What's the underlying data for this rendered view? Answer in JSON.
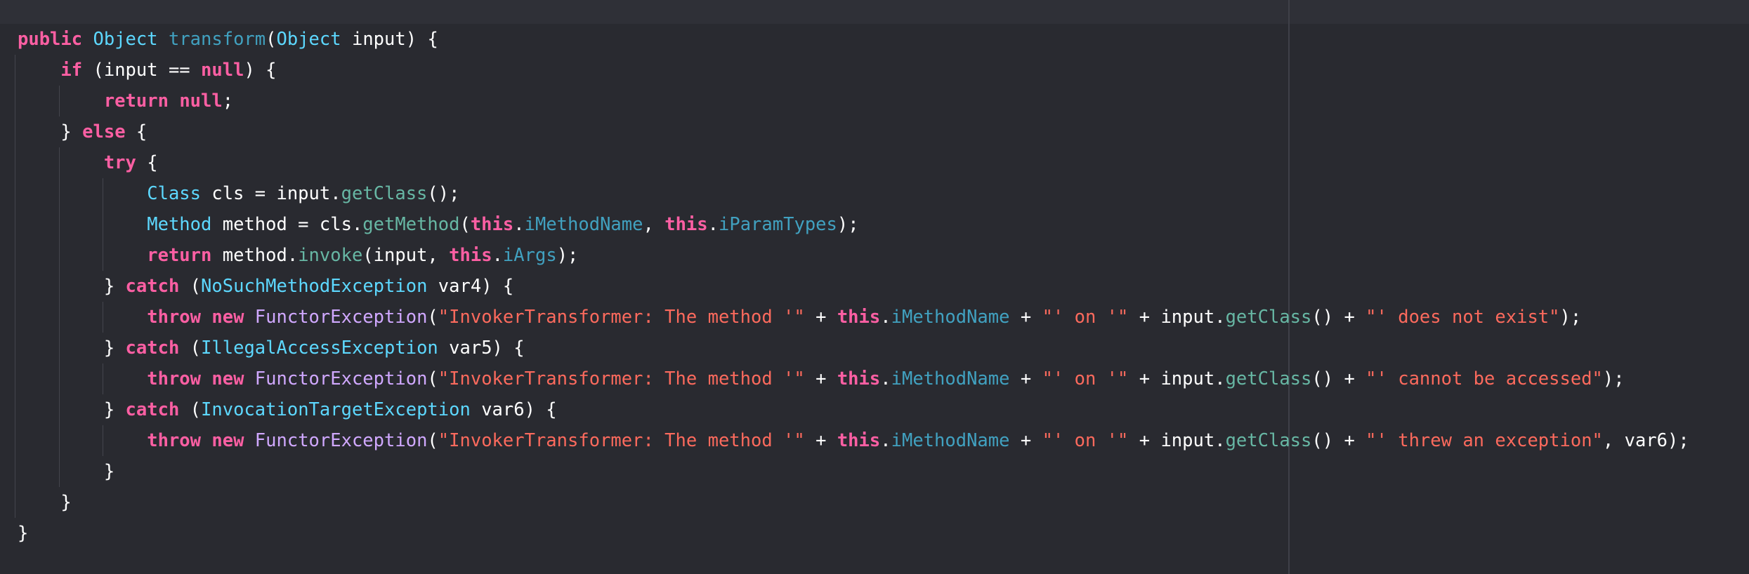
{
  "colors": {
    "background": "#292a30",
    "keyword": "#fc5fa3",
    "type": "#5dd8ff",
    "method_declaration": "#41a1c0",
    "method_call": "#67b7a4",
    "field": "#41a1c0",
    "class_reference": "#d0a8ff",
    "string": "#fc6a5d",
    "plain": "#ffffff"
  },
  "code": {
    "lines": [
      {
        "indent": 0,
        "tokens": [
          {
            "t": "keyword",
            "v": "public"
          },
          {
            "t": "plain",
            "v": " "
          },
          {
            "t": "type",
            "v": "Object"
          },
          {
            "t": "plain",
            "v": " "
          },
          {
            "t": "method-decl",
            "v": "transform"
          },
          {
            "t": "plain",
            "v": "("
          },
          {
            "t": "type",
            "v": "Object"
          },
          {
            "t": "plain",
            "v": " input) {"
          }
        ]
      },
      {
        "indent": 1,
        "tokens": [
          {
            "t": "keyword",
            "v": "if"
          },
          {
            "t": "plain",
            "v": " (input == "
          },
          {
            "t": "keyword",
            "v": "null"
          },
          {
            "t": "plain",
            "v": ") {"
          }
        ]
      },
      {
        "indent": 2,
        "tokens": [
          {
            "t": "keyword",
            "v": "return"
          },
          {
            "t": "plain",
            "v": " "
          },
          {
            "t": "keyword",
            "v": "null"
          },
          {
            "t": "plain",
            "v": ";"
          }
        ]
      },
      {
        "indent": 1,
        "tokens": [
          {
            "t": "plain",
            "v": "} "
          },
          {
            "t": "keyword",
            "v": "else"
          },
          {
            "t": "plain",
            "v": " {"
          }
        ]
      },
      {
        "indent": 2,
        "tokens": [
          {
            "t": "keyword",
            "v": "try"
          },
          {
            "t": "plain",
            "v": " {"
          }
        ]
      },
      {
        "indent": 3,
        "tokens": [
          {
            "t": "type",
            "v": "Class"
          },
          {
            "t": "plain",
            "v": " cls = input."
          },
          {
            "t": "method-call",
            "v": "getClass"
          },
          {
            "t": "plain",
            "v": "();"
          }
        ]
      },
      {
        "indent": 3,
        "tokens": [
          {
            "t": "type",
            "v": "Method"
          },
          {
            "t": "plain",
            "v": " method = cls."
          },
          {
            "t": "method-call",
            "v": "getMethod"
          },
          {
            "t": "plain",
            "v": "("
          },
          {
            "t": "keyword",
            "v": "this"
          },
          {
            "t": "plain",
            "v": "."
          },
          {
            "t": "field",
            "v": "iMethodName"
          },
          {
            "t": "plain",
            "v": ", "
          },
          {
            "t": "keyword",
            "v": "this"
          },
          {
            "t": "plain",
            "v": "."
          },
          {
            "t": "field",
            "v": "iParamTypes"
          },
          {
            "t": "plain",
            "v": ");"
          }
        ]
      },
      {
        "indent": 3,
        "tokens": [
          {
            "t": "keyword",
            "v": "return"
          },
          {
            "t": "plain",
            "v": " method."
          },
          {
            "t": "method-call",
            "v": "invoke"
          },
          {
            "t": "plain",
            "v": "(input, "
          },
          {
            "t": "keyword",
            "v": "this"
          },
          {
            "t": "plain",
            "v": "."
          },
          {
            "t": "field",
            "v": "iArgs"
          },
          {
            "t": "plain",
            "v": ");"
          }
        ]
      },
      {
        "indent": 2,
        "tokens": [
          {
            "t": "plain",
            "v": "} "
          },
          {
            "t": "keyword",
            "v": "catch"
          },
          {
            "t": "plain",
            "v": " ("
          },
          {
            "t": "type",
            "v": "NoSuchMethodException"
          },
          {
            "t": "plain",
            "v": " var4) {"
          }
        ]
      },
      {
        "indent": 3,
        "tokens": [
          {
            "t": "keyword",
            "v": "throw"
          },
          {
            "t": "plain",
            "v": " "
          },
          {
            "t": "keyword",
            "v": "new"
          },
          {
            "t": "plain",
            "v": " "
          },
          {
            "t": "class-ref",
            "v": "FunctorException"
          },
          {
            "t": "plain",
            "v": "("
          },
          {
            "t": "string",
            "v": "\"InvokerTransformer: The method '\""
          },
          {
            "t": "plain",
            "v": " + "
          },
          {
            "t": "keyword",
            "v": "this"
          },
          {
            "t": "plain",
            "v": "."
          },
          {
            "t": "field",
            "v": "iMethodName"
          },
          {
            "t": "plain",
            "v": " + "
          },
          {
            "t": "string",
            "v": "\"' on '\""
          },
          {
            "t": "plain",
            "v": " + input."
          },
          {
            "t": "method-call",
            "v": "getClass"
          },
          {
            "t": "plain",
            "v": "() + "
          },
          {
            "t": "string",
            "v": "\"' does not exist\""
          },
          {
            "t": "plain",
            "v": ");"
          }
        ]
      },
      {
        "indent": 2,
        "tokens": [
          {
            "t": "plain",
            "v": "} "
          },
          {
            "t": "keyword",
            "v": "catch"
          },
          {
            "t": "plain",
            "v": " ("
          },
          {
            "t": "type",
            "v": "IllegalAccessException"
          },
          {
            "t": "plain",
            "v": " var5) {"
          }
        ]
      },
      {
        "indent": 3,
        "tokens": [
          {
            "t": "keyword",
            "v": "throw"
          },
          {
            "t": "plain",
            "v": " "
          },
          {
            "t": "keyword",
            "v": "new"
          },
          {
            "t": "plain",
            "v": " "
          },
          {
            "t": "class-ref",
            "v": "FunctorException"
          },
          {
            "t": "plain",
            "v": "("
          },
          {
            "t": "string",
            "v": "\"InvokerTransformer: The method '\""
          },
          {
            "t": "plain",
            "v": " + "
          },
          {
            "t": "keyword",
            "v": "this"
          },
          {
            "t": "plain",
            "v": "."
          },
          {
            "t": "field",
            "v": "iMethodName"
          },
          {
            "t": "plain",
            "v": " + "
          },
          {
            "t": "string",
            "v": "\"' on '\""
          },
          {
            "t": "plain",
            "v": " + input."
          },
          {
            "t": "method-call",
            "v": "getClass"
          },
          {
            "t": "plain",
            "v": "() + "
          },
          {
            "t": "string",
            "v": "\"' cannot be accessed\""
          },
          {
            "t": "plain",
            "v": ");"
          }
        ]
      },
      {
        "indent": 2,
        "tokens": [
          {
            "t": "plain",
            "v": "} "
          },
          {
            "t": "keyword",
            "v": "catch"
          },
          {
            "t": "plain",
            "v": " ("
          },
          {
            "t": "type",
            "v": "InvocationTargetException"
          },
          {
            "t": "plain",
            "v": " var6) {"
          }
        ]
      },
      {
        "indent": 3,
        "tokens": [
          {
            "t": "keyword",
            "v": "throw"
          },
          {
            "t": "plain",
            "v": " "
          },
          {
            "t": "keyword",
            "v": "new"
          },
          {
            "t": "plain",
            "v": " "
          },
          {
            "t": "class-ref",
            "v": "FunctorException"
          },
          {
            "t": "plain",
            "v": "("
          },
          {
            "t": "string",
            "v": "\"InvokerTransformer: The method '\""
          },
          {
            "t": "plain",
            "v": " + "
          },
          {
            "t": "keyword",
            "v": "this"
          },
          {
            "t": "plain",
            "v": "."
          },
          {
            "t": "field",
            "v": "iMethodName"
          },
          {
            "t": "plain",
            "v": " + "
          },
          {
            "t": "string",
            "v": "\"' on '\""
          },
          {
            "t": "plain",
            "v": " + input."
          },
          {
            "t": "method-call",
            "v": "getClass"
          },
          {
            "t": "plain",
            "v": "() + "
          },
          {
            "t": "string",
            "v": "\"' threw an exception\""
          },
          {
            "t": "plain",
            "v": ", var6);"
          }
        ]
      },
      {
        "indent": 2,
        "tokens": [
          {
            "t": "plain",
            "v": "}"
          }
        ]
      },
      {
        "indent": 1,
        "tokens": [
          {
            "t": "plain",
            "v": "}"
          }
        ]
      },
      {
        "indent": 0,
        "tokens": [
          {
            "t": "plain",
            "v": "}"
          }
        ]
      }
    ]
  }
}
